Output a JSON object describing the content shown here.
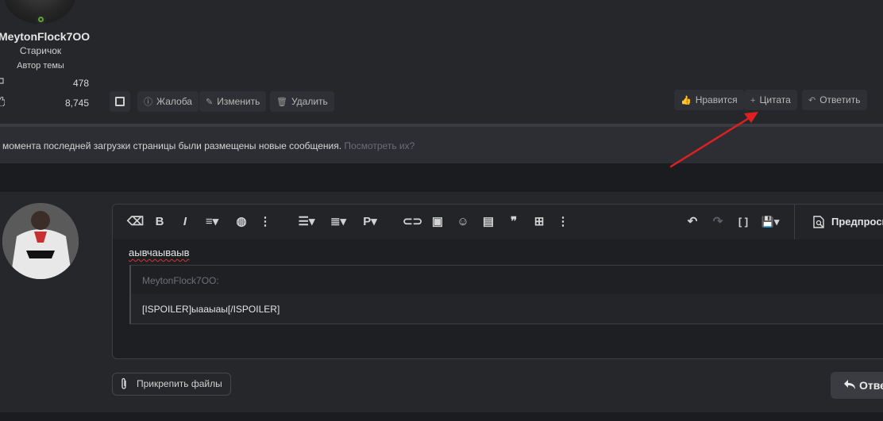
{
  "post": {
    "username": "MeytonFlock7OO",
    "user_title": "Старичок",
    "user_banner": "Автор темы",
    "stats": [
      {
        "icon": "messages-icon",
        "value": "478"
      },
      {
        "icon": "likes-icon",
        "value": "8,745"
      }
    ],
    "actions_left": [
      {
        "icon": "report-icon",
        "glyph": "ⓘ",
        "label": "Жалоба"
      },
      {
        "icon": "edit-icon",
        "glyph": "✎",
        "label": "Изменить"
      },
      {
        "icon": "trash-icon",
        "glyph": "🗑",
        "label": "Удалить"
      }
    ],
    "actions_right": [
      {
        "icon": "like-icon",
        "glyph": "👍",
        "label": "Нравится"
      },
      {
        "icon": "plus-icon",
        "glyph": "+",
        "label": "Цитата"
      },
      {
        "icon": "reply-icon",
        "glyph": "↶",
        "label": "Ответить"
      }
    ]
  },
  "notice": {
    "text": "момента последней загрузки страницы были размещены новые сообщения.",
    "link": "Посмотреть их?"
  },
  "editor": {
    "toolbar": [
      {
        "name": "clear-format-icon",
        "glyph": "⌫"
      },
      {
        "name": "bold-icon",
        "glyph": "B"
      },
      {
        "name": "italic-icon",
        "glyph": "I"
      },
      {
        "name": "text-style-icon",
        "glyph": "≡▾"
      },
      {
        "name": "palette-icon",
        "glyph": "◍"
      },
      {
        "name": "more-text-icon",
        "glyph": "⋮"
      },
      {
        "name": "list-icon",
        "glyph": "☰▾"
      },
      {
        "name": "align-icon",
        "glyph": "≣▾"
      },
      {
        "name": "paragraph-icon",
        "glyph": "P▾"
      },
      {
        "name": "link-icon",
        "glyph": "⊂⊃"
      },
      {
        "name": "image-icon",
        "glyph": "▣"
      },
      {
        "name": "emoji-icon",
        "glyph": "☺"
      },
      {
        "name": "media-icon",
        "glyph": "▤"
      },
      {
        "name": "quote-icon",
        "glyph": "❞"
      },
      {
        "name": "table-icon",
        "glyph": "⊞"
      },
      {
        "name": "more-insert-icon",
        "glyph": "⋮"
      },
      {
        "name": "undo-icon",
        "glyph": "↶"
      },
      {
        "name": "redo-icon",
        "glyph": "↷"
      },
      {
        "name": "bbcode-toggle-icon",
        "glyph": "[ ]"
      },
      {
        "name": "drafts-icon",
        "glyph": "💾▾"
      }
    ],
    "preview_label": "Предпросмотр",
    "text": "аывчаываыв",
    "quote": {
      "author": "MeytonFlock7OO:",
      "body": "[ISPOILER]ыааыаы[/ISPOILER]"
    },
    "attach_label": "Прикрепить файлы",
    "submit_label": "Ответить"
  },
  "colors": {
    "background": "#1b1c20",
    "panel": "#26272b",
    "annotation_arrow": "#e02020",
    "spellcheck": "#d23333"
  }
}
